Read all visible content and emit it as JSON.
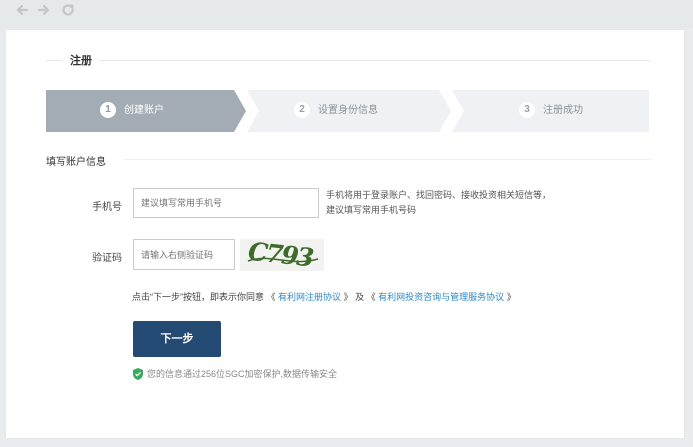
{
  "browser": {
    "back_icon": "back-arrow-icon",
    "forward_icon": "forward-arrow-icon",
    "reload_icon": "reload-icon"
  },
  "page": {
    "title": "注册"
  },
  "steps": [
    {
      "number": "1",
      "label": "创建账户",
      "state": "active"
    },
    {
      "number": "2",
      "label": "设置身份信息",
      "state": "pending"
    },
    {
      "number": "3",
      "label": "注册成功",
      "state": "pending"
    }
  ],
  "form": {
    "section_title": "填写账户信息",
    "phone": {
      "label": "手机号",
      "placeholder": "建议填写常用手机号",
      "value": "",
      "hint_line1": "手机将用于登录账户、找回密码、接收投资相关短信等，",
      "hint_line2": "建议填写常用手机号码"
    },
    "captcha": {
      "label": "验证码",
      "placeholder": "请输入右侧验证码",
      "value": "",
      "image_text": "C793"
    },
    "agreement": {
      "prefix": "点击“下一步”按钮，即表示你同意",
      "link1": "有利网注册协议",
      "middle": "及",
      "link2": "有利网投资咨询与管理服务协议"
    },
    "next_label": "下一步",
    "security_note": "您的信息通过256位SGC加密保护,数据传输安全"
  },
  "colors": {
    "active_step": "#a3abb4",
    "pending_step": "#eff1f4",
    "primary_button": "#234a72",
    "link": "#2c86c8",
    "secure_icon": "#3aab5e"
  }
}
